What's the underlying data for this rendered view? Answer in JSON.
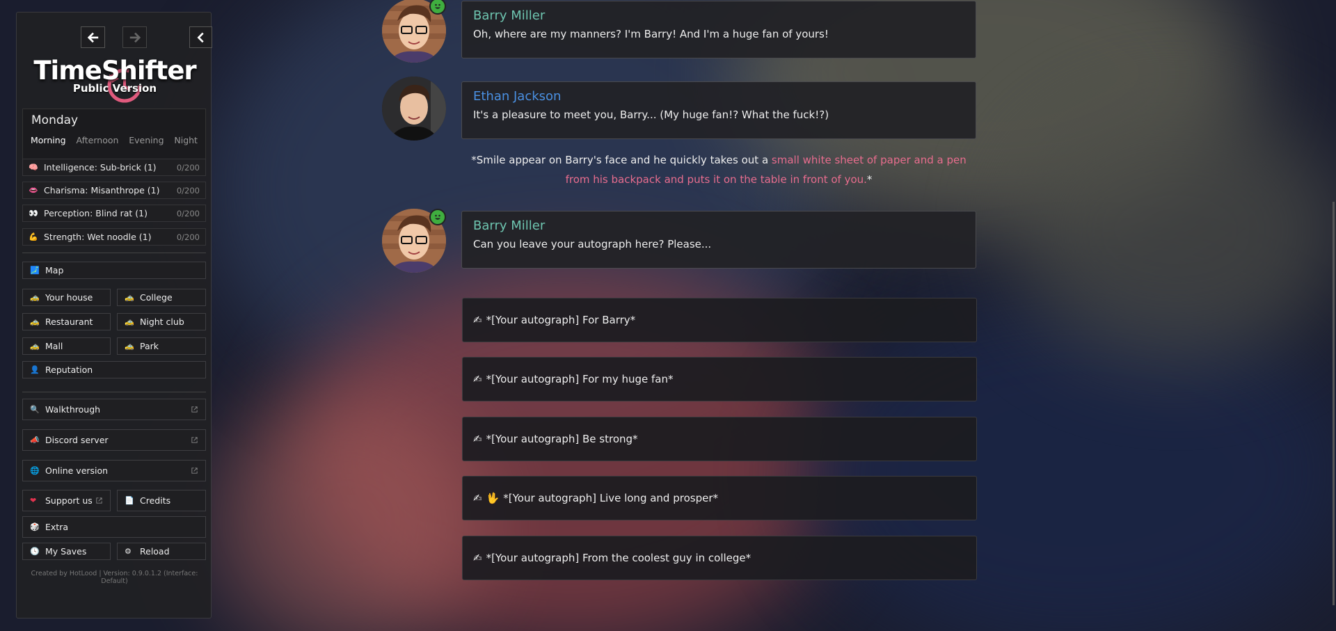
{
  "sidebar": {
    "logo": {
      "title": "TimeShifter",
      "subtitle": "Public Version"
    },
    "day": "Monday",
    "times": [
      "Morning",
      "Afternoon",
      "Evening",
      "Night"
    ],
    "active_time": "Morning",
    "stats": [
      {
        "icon": "brain-icon",
        "label": "Intelligence: Sub-brick (1)",
        "value": "0/200"
      },
      {
        "icon": "lips-icon",
        "label": "Charisma: Misanthrope (1)",
        "value": "0/200"
      },
      {
        "icon": "eyes-icon",
        "label": "Perception: Blind rat (1)",
        "value": "0/200"
      },
      {
        "icon": "flexed-biceps-icon",
        "label": "Strength: Wet noodle (1)",
        "value": "0/200"
      }
    ],
    "map": "Map",
    "locations": [
      "Your house",
      "College",
      "Restaurant",
      "Night club",
      "Mall",
      "Park"
    ],
    "reputation": "Reputation",
    "walkthrough": "Walkthrough",
    "discord": "Discord server",
    "online": "Online version",
    "support": "Support us",
    "credits": "Credits",
    "extra": "Extra",
    "saves": "My Saves",
    "reload": "Reload",
    "footer": "Created by HotLood | Version: 0.9.0.1.2 (Interface: Default)"
  },
  "dialog": [
    {
      "speaker": "Barry Miller",
      "color": "#6ec5b0",
      "text": "Oh, where are my manners? I'm Barry! And I'm a huge fan of yours!"
    },
    {
      "speaker": "Ethan Jackson",
      "color": "#4a90e2",
      "text": "It's a pleasure to meet you, Barry... (My huge fan!? What the fuck!?)"
    },
    {
      "narration_plain": "*Smile appear on Barry's face and he quickly takes out a ",
      "narration_highlight": "small white sheet of paper and a pen from his backpack and puts it on the table in front of you.",
      "narration_end": "*"
    },
    {
      "speaker": "Barry Miller",
      "color": "#6ec5b0",
      "text": "Can you leave your autograph here? Please..."
    }
  ],
  "choices": [
    "*[Your autograph] For Barry*",
    "*[Your autograph] For my huge fan*",
    "*[Your autograph] Be strong*",
    "*[Your autograph] Live long and prosper*",
    "*[Your autograph] From the coolest guy in college*"
  ],
  "colors": {
    "barry": "#6ec5b0",
    "ethan": "#4a90e2",
    "highlight": "#e86d8e"
  }
}
